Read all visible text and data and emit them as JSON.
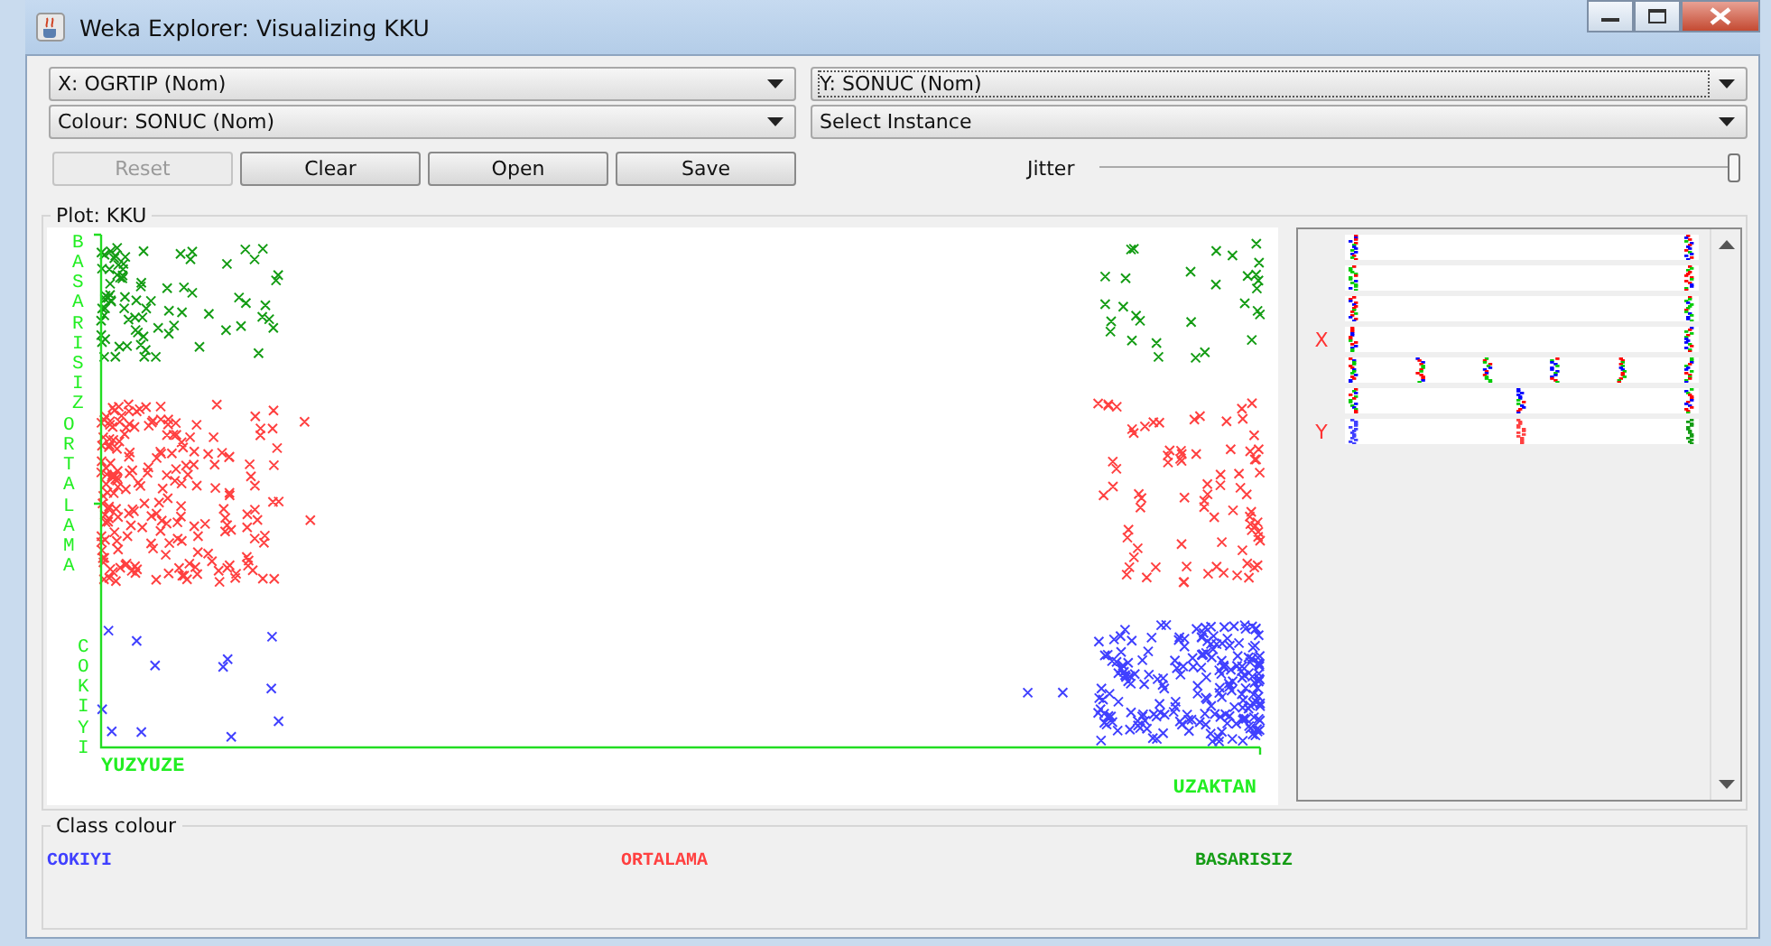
{
  "window": {
    "title": "Weka Explorer: Visualizing KKU"
  },
  "selectors": [
    {
      "label": "X: OGRTIP (Nom)",
      "focused": false
    },
    {
      "label": "Y: SONUC (Nom)",
      "focused": true
    },
    {
      "label": "Colour: SONUC (Nom)",
      "focused": false
    },
    {
      "label": "Select Instance",
      "focused": false
    }
  ],
  "buttons": [
    {
      "label": "Reset",
      "disabled": true
    },
    {
      "label": "Clear",
      "disabled": false
    },
    {
      "label": "Open",
      "disabled": false
    },
    {
      "label": "Save",
      "disabled": false
    }
  ],
  "jitter": {
    "label": "Jitter",
    "level": 1
  },
  "plot": {
    "title": "Plot: KKU",
    "x_categories": [
      "YUZYUZE",
      "UZAKTAN"
    ],
    "y_categories": [
      "BASARISIZ",
      "ORTALAMA",
      "COKIYI"
    ]
  },
  "attribute_panel": {
    "x_marker": "X",
    "y_marker": "Y",
    "rows": [
      {
        "x_axis": false,
        "y_axis": false
      },
      {
        "x_axis": false,
        "y_axis": false
      },
      {
        "x_axis": false,
        "y_axis": false
      },
      {
        "x_axis": true,
        "y_axis": false
      },
      {
        "x_axis": false,
        "y_axis": false
      },
      {
        "x_axis": false,
        "y_axis": false
      },
      {
        "x_axis": false,
        "y_axis": true
      }
    ]
  },
  "class_colour": {
    "title": "Class colour",
    "classes": [
      {
        "name": "COKIYI",
        "color": "#4040ff"
      },
      {
        "name": "ORTALAMA",
        "color": "#ff4040"
      },
      {
        "name": "BASARISIZ",
        "color": "#149c14"
      }
    ]
  }
}
